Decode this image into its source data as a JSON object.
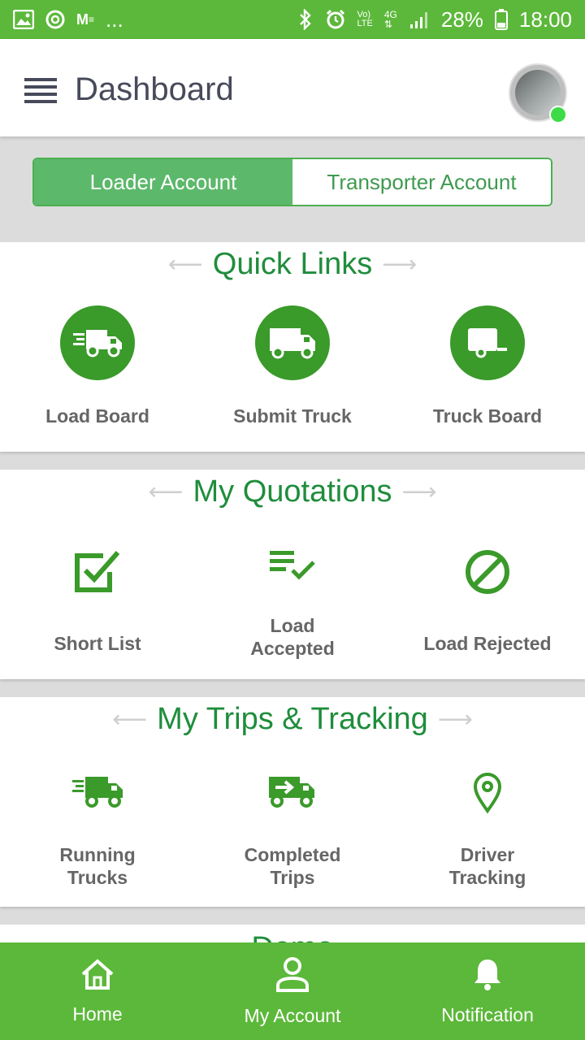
{
  "status_bar": {
    "left_icons": [
      "gallery-icon",
      "c-app-icon",
      "m-app-icon",
      "more-dots-icon"
    ],
    "more": "...",
    "right_icons": [
      "bluetooth-icon",
      "alarm-icon",
      "volte-icon",
      "4g-icon",
      "signal-icon",
      "battery-icon"
    ],
    "battery": "28%",
    "time": "18:00"
  },
  "header": {
    "title": "Dashboard",
    "avatar_status_color": "#3ddc46"
  },
  "account_tabs": [
    {
      "label": "Loader Account",
      "active": true
    },
    {
      "label": "Transporter Account",
      "active": false
    }
  ],
  "sections": {
    "quick_links": {
      "title": "Quick Links",
      "items": [
        {
          "label": "Load Board",
          "icon": "fast-truck-icon"
        },
        {
          "label": "Submit Truck",
          "icon": "truck-icon"
        },
        {
          "label": "Truck Board",
          "icon": "trailer-icon"
        }
      ]
    },
    "quotations": {
      "title": "My Quotations",
      "items": [
        {
          "label": "Short List",
          "icon": "checkbox-icon"
        },
        {
          "label": "Load Accepted",
          "line1": "Load",
          "line2": "Accepted",
          "icon": "list-check-icon"
        },
        {
          "label": "Load Rejected",
          "icon": "block-icon"
        }
      ]
    },
    "trips": {
      "title": "My Trips & Tracking",
      "items": [
        {
          "label": "Running Trucks",
          "line1": "Running",
          "line2": "Trucks",
          "icon": "fast-truck-icon"
        },
        {
          "label": "Completed Trips",
          "line1": "Completed",
          "line2": "Trips",
          "icon": "truck-arrow-icon"
        },
        {
          "label": "Driver Tracking",
          "line1": "Driver",
          "line2": "Tracking",
          "icon": "map-pin-icon"
        }
      ]
    },
    "next_peek": "Demo"
  },
  "bottom_nav": [
    {
      "label": "Home",
      "icon": "home-icon"
    },
    {
      "label": "My Account",
      "icon": "account-icon"
    },
    {
      "label": "Notification",
      "icon": "bell-icon"
    }
  ],
  "colors": {
    "brand_green": "#5cb83a",
    "title_green": "#1f8d3c",
    "icon_green": "#3a9a2a"
  }
}
